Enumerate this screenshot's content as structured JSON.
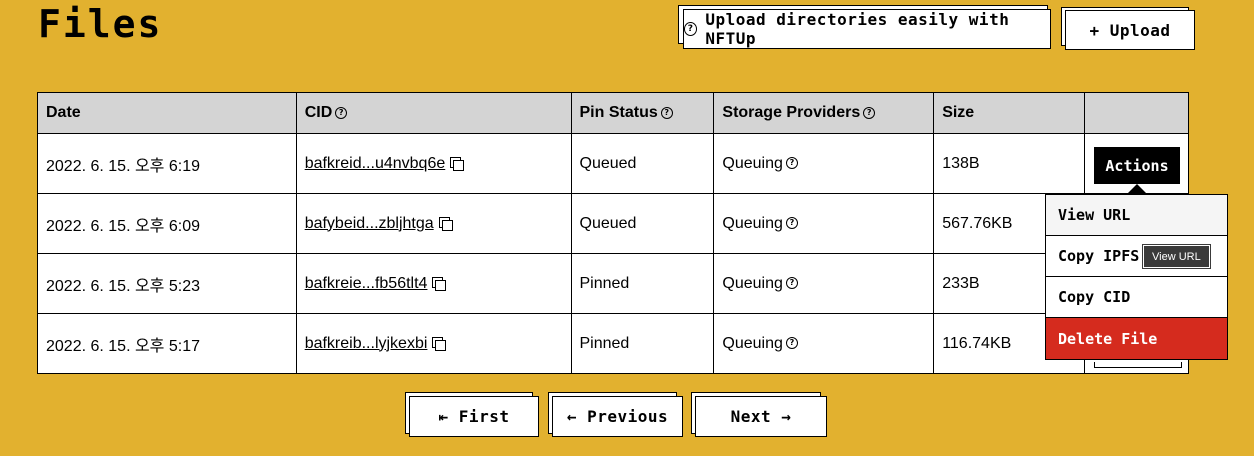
{
  "page": {
    "title": "Files",
    "nftup_button": "Upload directories easily with NFTUp",
    "upload_button": "+ Upload"
  },
  "table": {
    "headers": [
      "Date",
      "CID",
      "Pin Status",
      "Storage Providers",
      "Size"
    ],
    "rows": [
      {
        "date": "2022. 6. 15. 오후 6:19",
        "cid": "bafkreid...u4nvbq6e",
        "pin_status": "Queued",
        "storage": "Queuing",
        "size": "138B"
      },
      {
        "date": "2022. 6. 15. 오후 6:09",
        "cid": "bafybeid...zbljhtga",
        "pin_status": "Queued",
        "storage": "Queuing",
        "size": "567.76KB"
      },
      {
        "date": "2022. 6. 15. 오후 5:23",
        "cid": "bafkreie...fb56tlt4",
        "pin_status": "Pinned",
        "storage": "Queuing",
        "size": "233B"
      },
      {
        "date": "2022. 6. 15. 오후 5:17",
        "cid": "bafkreib...lyjkexbi",
        "pin_status": "Pinned",
        "storage": "Queuing",
        "size": "116.74KB"
      }
    ]
  },
  "actions": {
    "button_label": "Actions",
    "menu": [
      "View URL",
      "Copy IPFS",
      "Copy CID",
      "Delete File"
    ],
    "tooltip": "View URL"
  },
  "pagination": {
    "first": "⇤ First",
    "previous": "← Previous",
    "next": "Next →"
  },
  "colors": {
    "background": "#E2B12F",
    "header_bg": "#D4D4D4",
    "delete_bg": "#D52B1E"
  }
}
